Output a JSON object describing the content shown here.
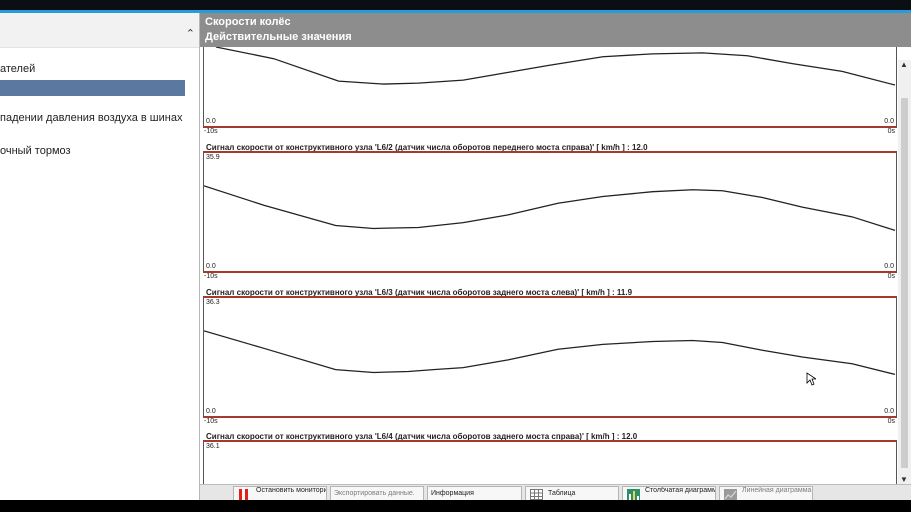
{
  "left_panel": {
    "items": [
      {
        "label": "ателей"
      },
      {
        "label": ""
      },
      {
        "label": " падении давления воздуха в шинах"
      },
      {
        "label": "очный тормоз"
      }
    ]
  },
  "right_panel": {
    "title": "Скорости колёс",
    "subtitle": "Действительные значения"
  },
  "charts": [
    {
      "title": "",
      "ymax_label": "",
      "ymin_label": "0.0",
      "ymin_right_label": "0.0",
      "x_start_label": "-10s",
      "x_end_label": "0s"
    },
    {
      "title": "Сигнал скорости от конструктивного узла 'L6/2 (датчик числа оборотов переднего моста справа)' [ km/h ] : 12.0",
      "ymax_label": "35.9",
      "ymin_label": "0.0",
      "ymin_right_label": "0.0",
      "x_start_label": "-10s",
      "x_end_label": "0s"
    },
    {
      "title": "Сигнал скорости от конструктивного узла 'L6/3 (датчик числа оборотов заднего моста слева)' [ km/h ] : 11.9",
      "ymax_label": "36.3",
      "ymin_label": "0.0",
      "ymin_right_label": "0.0",
      "x_start_label": "-10s",
      "x_end_label": "0s"
    },
    {
      "title": "Сигнал скорости от конструктивного узла 'L6/4 (датчик числа оборотов заднего моста справа)' [ km/h ] : 12.0",
      "ymax_label": "36.1"
    }
  ],
  "toolbar": {
    "stop": "Остановить мониторинг",
    "export": "Экспортировать данные.",
    "info": "Информация",
    "table": "Таблица",
    "bar": "Столбчатая диаграмма",
    "line": "Линейная диаграмма"
  },
  "icons": {
    "stop": "stop-bars-icon",
    "table": "table-grid-icon",
    "bar": "bar-chart-icon",
    "line": "line-chart-icon",
    "scroll_up": "chevron-up-icon",
    "scroll_down": "chevron-down-icon",
    "collapse": "chevron-up-icon"
  },
  "colors": {
    "header_bg": "#8d8d8d",
    "selection": "#5b79a0",
    "plot_border": "#a53a2c",
    "accent": "#2a9ad8",
    "stop_red": "#e0201a"
  }
}
